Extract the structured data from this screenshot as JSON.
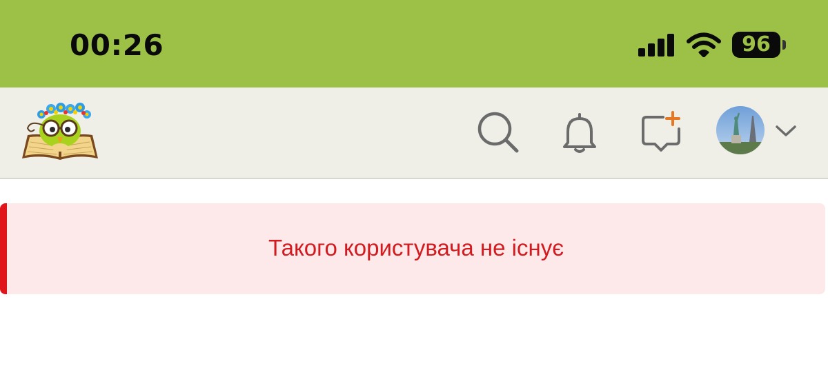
{
  "status_bar": {
    "time": "00:26",
    "battery_level": "96",
    "icons": [
      "cellular-signal-icon",
      "wifi-icon",
      "battery-icon"
    ],
    "background_color": "#9dc146"
  },
  "header": {
    "logo": "owl-with-flower-wreath-reading-book-logo",
    "icons": [
      "search-icon",
      "bell-icon",
      "new-post-icon",
      "user-avatar",
      "chevron-down-icon"
    ],
    "accent_color": "#e87722",
    "background_color": "#efefe8"
  },
  "alert": {
    "message": "Такого користувача не існує",
    "type": "error",
    "text_color": "#d21a1f",
    "background_color": "#fde9ea",
    "border_color": "#e0141b"
  }
}
